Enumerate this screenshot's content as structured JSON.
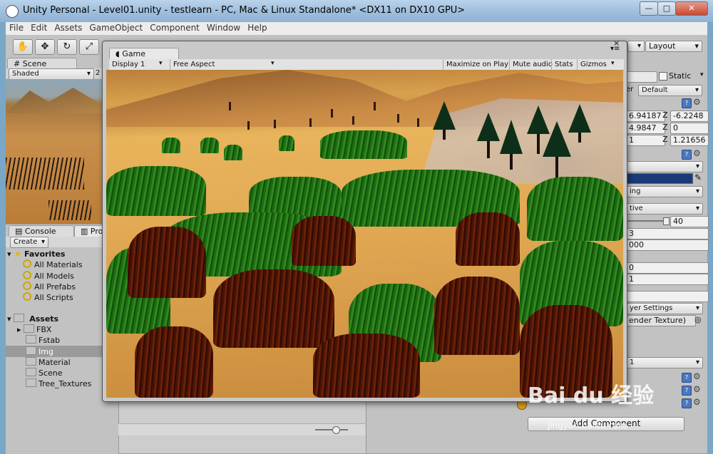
{
  "window": {
    "title": "Unity Personal - Level01.unity - testlearn - PC, Mac & Linux Standalone* <DX11 on DX10 GPU>",
    "min_label": "—",
    "max_label": "□",
    "close_label": "✕"
  },
  "menu": [
    "File",
    "Edit",
    "Assets",
    "GameObject",
    "Component",
    "Window",
    "Help"
  ],
  "toolbar": {
    "tools": [
      "✋",
      "✥",
      "↻",
      "⤢"
    ],
    "layers_label": "",
    "layout_label": "Layout"
  },
  "scene_panel": {
    "tab_label": "Scene",
    "shading_mode": "Shaded",
    "extra_label": "2"
  },
  "game_panel": {
    "tab_label": "Game",
    "display": "Display 1",
    "aspect": "Free Aspect",
    "maximize_on_play": "Maximize on Play",
    "mute_audio": "Mute audio",
    "stats": "Stats",
    "gizmos": "Gizmos"
  },
  "bottom_tabs": {
    "console": "Console",
    "project": "Pro"
  },
  "project": {
    "create_label": "Create",
    "favorites_label": "Favorites",
    "favorites": [
      "All Materials",
      "All Models",
      "All Prefabs",
      "All Scripts"
    ],
    "assets_label": "Assets",
    "folders": [
      "FBX",
      "Fstab",
      "Img",
      "Material",
      "Scene",
      "Tree_Textures"
    ],
    "selected_folder": "Img"
  },
  "inspector": {
    "static_label": "Static",
    "layer_label": "er",
    "layer_value": "Default",
    "pos_x": "6.94187",
    "pos_z_label": "Z",
    "pos_z": "-6.2248",
    "rot_x": "4.9847",
    "rot_z_label": "Z",
    "rot_z": "0",
    "scale_x": "1",
    "scale_z_label": "Z",
    "scale_z": "1.21656",
    "dd_ing": "ing",
    "dd_tive": "tive",
    "slider_value": "40",
    "val_3": "3",
    "val_000": "000",
    "val_0": "0",
    "val_1": "1",
    "layer_settings": "yer Settings",
    "render_texture": "ender Texture)",
    "dd_1": "1",
    "add_component": "Add Component"
  },
  "watermark": {
    "logo": "Bai du 经验",
    "url": "jingyan.baidu.com"
  }
}
